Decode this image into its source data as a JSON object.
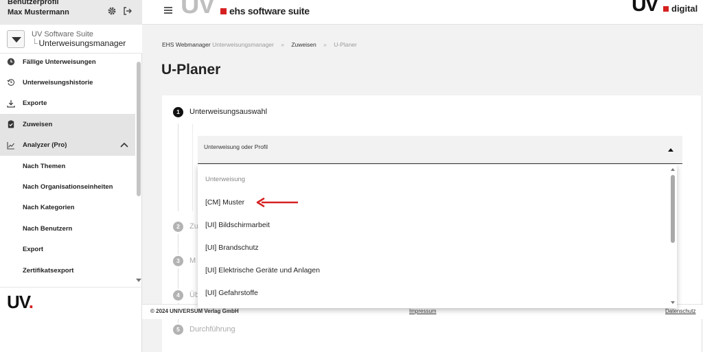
{
  "sidebar": {
    "profile_label": "Benutzerprofil",
    "user_name": "Max Mustermann",
    "app_switch": {
      "suite": "UV Software Suite",
      "prefix": "└",
      "app": "Unterweisungsmanager"
    },
    "items": [
      {
        "label": "Fällige Unterweisungen",
        "icon": "clock-icon"
      },
      {
        "label": "Unterweisungshistorie",
        "icon": "history-icon"
      },
      {
        "label": "Exporte",
        "icon": "download-icon"
      },
      {
        "label": "Zuweisen",
        "icon": "clipboard-check-icon",
        "active": true
      },
      {
        "label": "Analyzer (Pro)",
        "icon": "chart-line-icon",
        "expanded": true
      },
      {
        "label": "Nach Themen"
      },
      {
        "label": "Nach Organisationseinheiten"
      },
      {
        "label": "Nach Kategorien"
      },
      {
        "label": "Nach Benutzern"
      },
      {
        "label": "Export"
      },
      {
        "label": "Zertifikatsexport"
      }
    ],
    "logo": {
      "text": "UV",
      "dot": "."
    }
  },
  "header": {
    "brand_left_uv": "UV",
    "brand_left_text": "ehs software suite",
    "brand_right_uv": "UV",
    "brand_right_text": "digital"
  },
  "breadcrumb": {
    "items": [
      "EHS Webmanager",
      "Unterweisungsmanager",
      "Zuweisen",
      "U-Planer"
    ],
    "separator": "»"
  },
  "page_title": "U-Planer",
  "steps": [
    {
      "num": "1",
      "label": "Unterweisungsauswahl",
      "active": true
    },
    {
      "num": "2",
      "label": "Zu",
      "active": false
    },
    {
      "num": "3",
      "label": "M",
      "active": false
    },
    {
      "num": "4",
      "label": "Üb",
      "active": false
    },
    {
      "num": "5",
      "label": "Durchführung",
      "active": false
    }
  ],
  "select": {
    "placeholder": "Unterweisung oder Profil"
  },
  "dropdown": {
    "group": "Unterweisung",
    "options": [
      "[CM] Muster",
      "[UI] Bildschirmarbeit",
      "[UI] Brandschutz",
      "[UI] Elektrische Geräte und Anlagen",
      "[UI] Gefahrstoffe"
    ]
  },
  "footer": {
    "copyright": "© 2024 UNIVERSUM Verlag GmbH",
    "impressum": "Impressum",
    "datenschutz": "Datenschutz"
  },
  "colors": {
    "accent_red": "#d62020",
    "active_nav_bg": "#e4e4e4"
  }
}
